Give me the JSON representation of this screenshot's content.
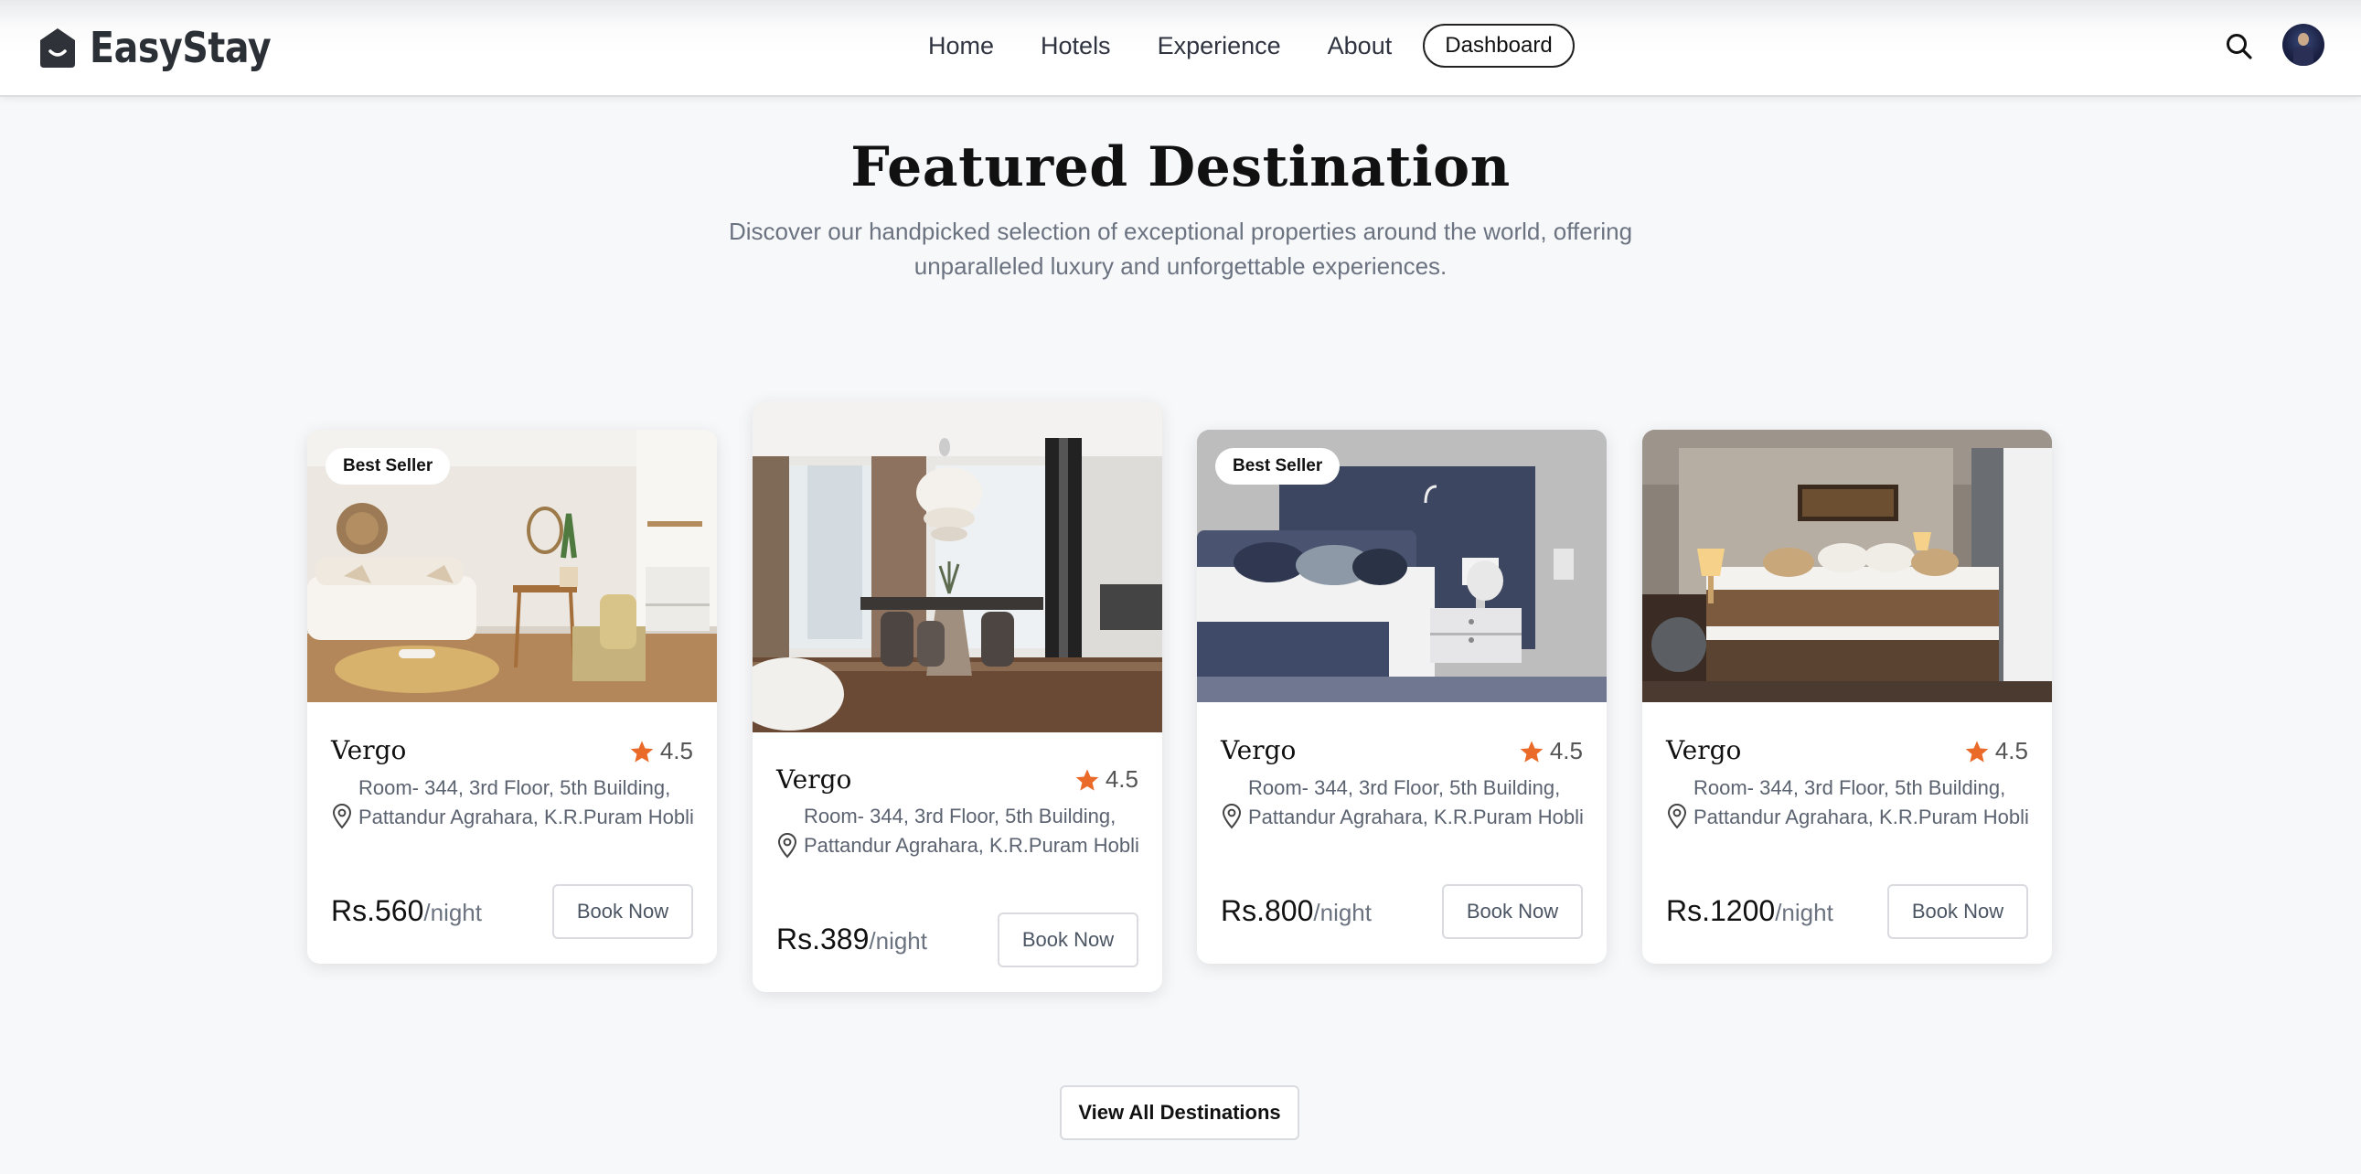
{
  "brand": {
    "name": "EasyStay",
    "icon": "house-smile-icon"
  },
  "nav": {
    "links": [
      "Home",
      "Hotels",
      "Experience",
      "About"
    ],
    "dashboard_label": "Dashboard",
    "search_icon": "search-icon",
    "avatar": "user-avatar"
  },
  "header": {
    "title": "Featured Destination",
    "subtitle": "Discover our handpicked selection of exceptional properties around the world, offering unparalleled luxury and unforgettable experiences."
  },
  "cards": [
    {
      "badge": "Best Seller",
      "name": "Vergo",
      "rating": "4.5",
      "address": "Room- 344, 3rd Floor, 5th Building, Pattandur Agrahara, K.R.Puram Hobli",
      "price": "Rs.560",
      "unit": "/night",
      "button": "Book Now",
      "image": "living-room"
    },
    {
      "badge": "",
      "name": "Vergo",
      "rating": "4.5",
      "address": "Room- 344, 3rd Floor, 5th Building, Pattandur Agrahara, K.R.Puram Hobli",
      "price": "Rs.389",
      "unit": "/night",
      "button": "Book Now",
      "image": "dining-room"
    },
    {
      "badge": "Best Seller",
      "name": "Vergo",
      "rating": "4.5",
      "address": "Room- 344, 3rd Floor, 5th Building, Pattandur Agrahara, K.R.Puram Hobli",
      "price": "Rs.800",
      "unit": "/night",
      "button": "Book Now",
      "image": "navy-bedroom"
    },
    {
      "badge": "",
      "name": "Vergo",
      "rating": "4.5",
      "address": "Room- 344, 3rd Floor, 5th Building, Pattandur Agrahara, K.R.Puram Hobli",
      "price": "Rs.1200",
      "unit": "/night",
      "button": "Book Now",
      "image": "hotel-bedroom"
    }
  ],
  "view_all_label": "View All Destinations",
  "colors": {
    "accent_star": "#ea6a2a",
    "text_dark": "#111111",
    "muted": "#6b7280"
  }
}
